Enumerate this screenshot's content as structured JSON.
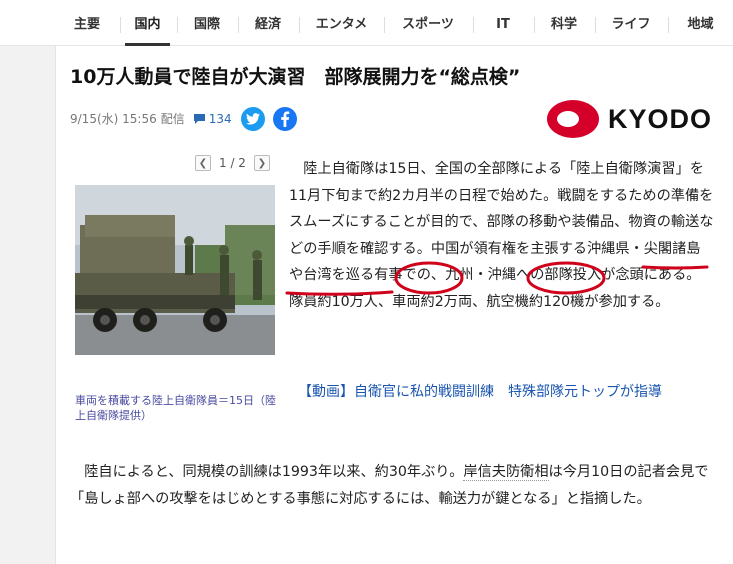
{
  "nav": {
    "items": [
      "主要",
      "国内",
      "国際",
      "経済",
      "エンタメ",
      "スポーツ",
      "IT",
      "科学",
      "ライフ",
      "地域"
    ],
    "active": "国内"
  },
  "article": {
    "headline": "10万人動員で陸自が大演習　部隊展開力を“総点検”",
    "date": "9/15(水) 15:56",
    "date_suffix": "配信",
    "comment_count": "134",
    "source": "KYODO",
    "pager": "1 / 2",
    "caption": "車両を積載する陸上自衛隊員＝15日（陸上自衛隊提供）",
    "body_p1": "陸上自衛隊は15日、全国の全部隊による「陸上自衛隊演習」を11月下旬まで約2カ月半の日程で始めた。戦闘をするための準備をスムーズにすることが目的で、部隊の移動や装備品、物資の輸送などの手順を確認する。中国が領有権を主張する沖縄県・尖閣諸島や台湾を巡る有事での、九州・沖縄への部隊投入が念頭にある。隊員約10万人、車両約2万両、航空機約120機が参加する。",
    "related_link": "【動画】自衛官に私的戦闘訓練　特殊部隊元トップが指導",
    "body_p2_a": "陸自によると、同規模の訓練は1993年以来、約30年ぶり。",
    "body_p2_link": "岸信夫防衛相",
    "body_p2_b": "は今月10日の記者会見で「島しょ部への攻撃をはじめとする事態に対応するには、輸送力が鍵となる」と指摘した。"
  },
  "colors": {
    "annotation": "#d0021b",
    "link": "#1a56b0",
    "twitter": "#1d9bf0",
    "facebook": "#1877f2",
    "kyodo_red": "#d4002a"
  }
}
